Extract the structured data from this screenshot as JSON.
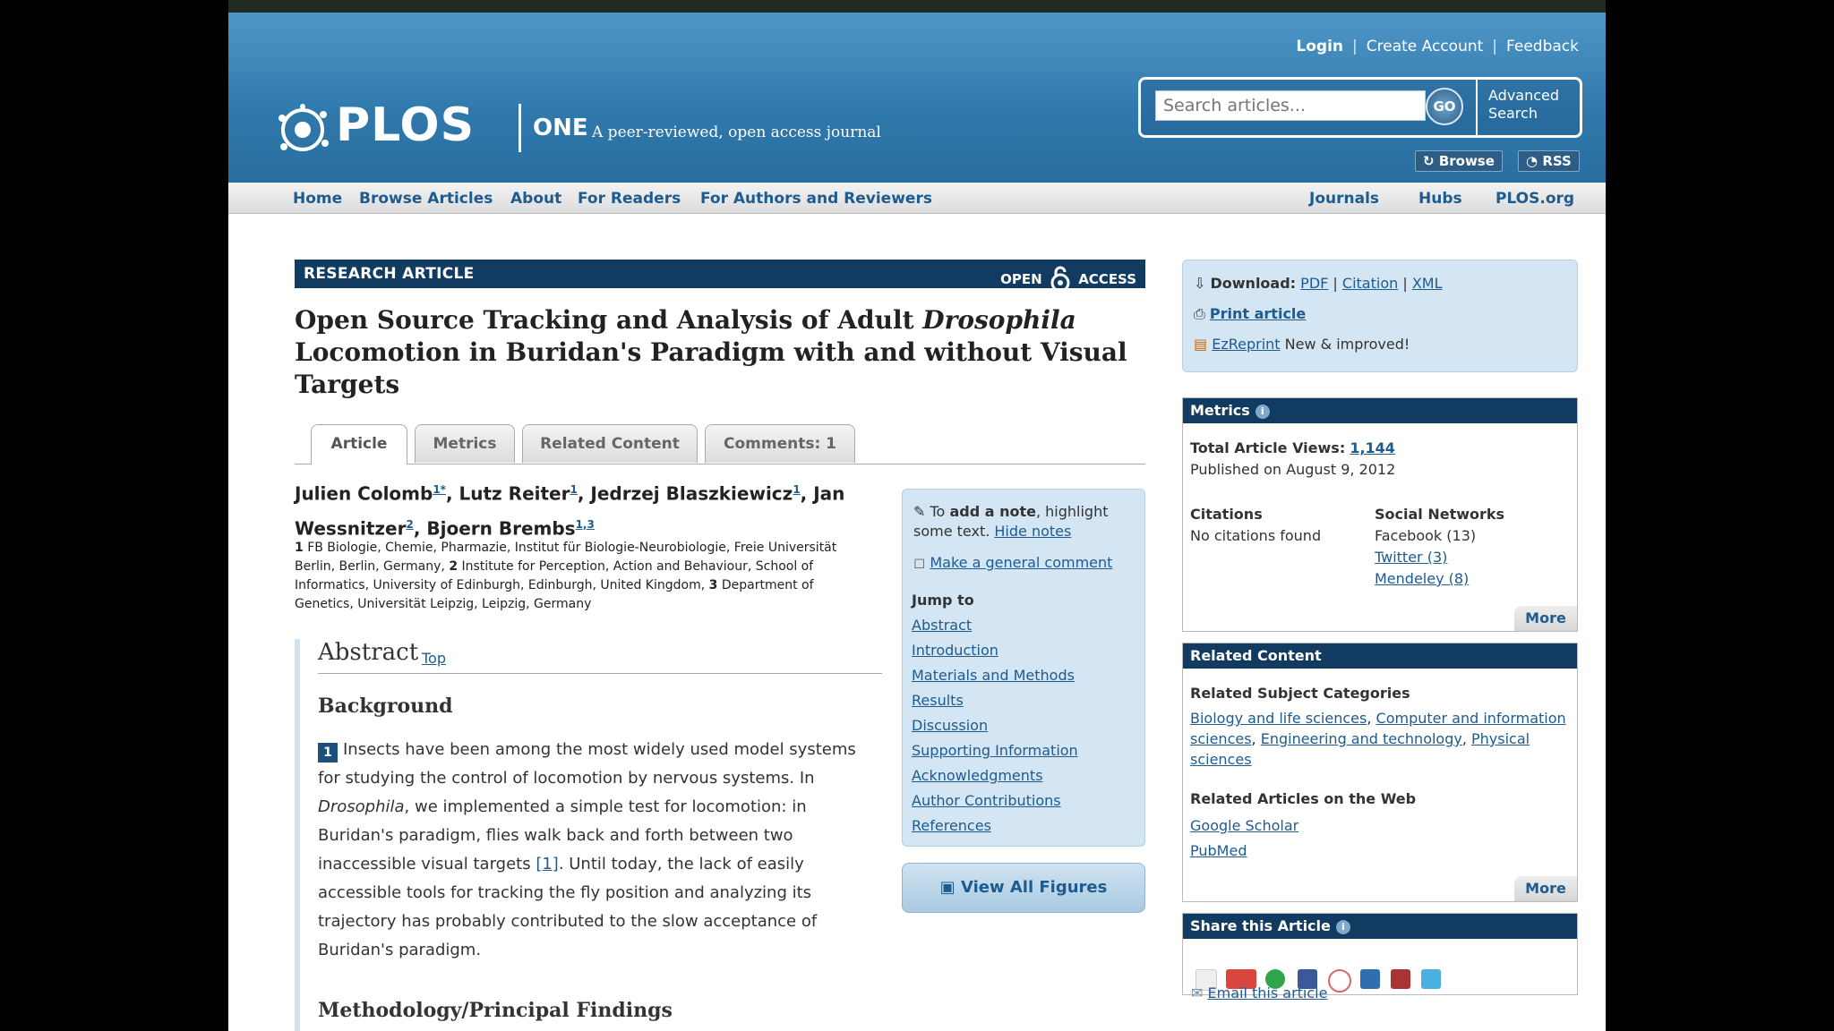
{
  "header": {
    "login": "Login",
    "create_account": "Create Account",
    "feedback": "Feedback",
    "logo_plos": "PLOS",
    "logo_one": "ONE",
    "tagline": "A peer-reviewed, open access journal",
    "search_placeholder": "Search articles...",
    "go": "GO",
    "advanced_search": "Advanced Search",
    "browse": "Browse",
    "rss": "RSS"
  },
  "nav": {
    "home": "Home",
    "browse_articles": "Browse Articles",
    "about": "About",
    "for_readers": "For Readers",
    "for_authors": "For Authors and Reviewers",
    "journals": "Journals",
    "hubs": "Hubs",
    "plos_org": "PLOS.org"
  },
  "article": {
    "type_label": "RESEARCH ARTICLE",
    "open": "OPEN",
    "access": "ACCESS",
    "title_part1": "Open Source Tracking and Analysis of Adult ",
    "title_italic": "Drosophila",
    "title_part2": " Locomotion in Buridan's Paradigm with and without Visual Targets",
    "tabs": [
      "Article",
      "Metrics",
      "Related Content",
      "Comments: 1"
    ],
    "authors": [
      {
        "name": "Julien Colomb",
        "sup": "1*"
      },
      {
        "name": "Lutz Reiter",
        "sup": "1"
      },
      {
        "name": "Jedrzej Blaszkiewicz",
        "sup": "1"
      },
      {
        "name": "Jan Wessnitzer",
        "sup": "2"
      },
      {
        "name": "Bjoern Brembs",
        "sup": "1,3"
      }
    ],
    "affil_1": "FB Biologie, Chemie, Pharmazie, Institut für Biologie-Neurobiologie, Freie Universität Berlin, Berlin, Germany,",
    "affil_2": "Institute for Perception, Action and Behaviour, School of Informatics, University of Edinburgh, Edinburgh, United Kingdom,",
    "affil_3": "Department of Genetics, Universität Leipzig, Leipzig, Germany",
    "abstract_heading": "Abstract",
    "top_link": "Top",
    "background_heading": "Background",
    "badge": "1",
    "para_a": "Insects have been among the most widely used model systems for studying the control of locomotion by nervous systems. In ",
    "para_italic": "Drosophila",
    "para_b": ", we implemented a simple test for locomotion: in Buridan's paradigm, flies walk back and forth between two inaccessible visual targets ",
    "para_ref": "[1]",
    "para_c": ". Until today, the lack of easily accessible tools for tracking the fly position and analyzing its trajectory has probably contributed to the slow acceptance of Buridan's paradigm.",
    "methods_heading": "Methodology/Principal Findings"
  },
  "notes": {
    "to": "To ",
    "add_note": "add a note",
    "highlight": ", highlight some text. ",
    "hide_notes": "Hide notes",
    "general_comment": "Make a general comment",
    "jump_to": "Jump to",
    "links": [
      "Abstract",
      "Introduction",
      "Materials and Methods",
      "Results",
      "Discussion",
      "Supporting Information",
      "Acknowledgments",
      "Author Contributions",
      "References"
    ]
  },
  "view_all_figures": "View All Figures",
  "download": {
    "label": "Download:",
    "pdf": "PDF",
    "citation": "Citation",
    "xml": "XML",
    "print": "Print article",
    "ezreprint": "EzReprint",
    "new_improved": "New & improved!"
  },
  "metrics": {
    "heading": "Metrics",
    "total_views_label": "Total Article Views:",
    "total_views": "1,144",
    "published": "Published on August 9, 2012",
    "citations_heading": "Citations",
    "citations_value": "No citations found",
    "social_heading": "Social Networks",
    "facebook": "Facebook (13)",
    "twitter": "Twitter (3)",
    "mendeley": "Mendeley (8)",
    "more": "More"
  },
  "related": {
    "heading": "Related Content",
    "subject_heading": "Related Subject Categories",
    "cat1": "Biology and life sciences",
    "cat2": "Computer and information sciences",
    "cat3": "Engineering and technology",
    "cat4": "Physical sciences",
    "web_heading": "Related Articles on the Web",
    "google_scholar": "Google Scholar",
    "pubmed": "PubMed",
    "more": "More"
  },
  "share": {
    "heading": "Share this Article",
    "email": "Email this article"
  },
  "colors": {
    "brand_dark": "#123b61",
    "link": "#1e5b8f",
    "header_blue": "#3a82b5"
  }
}
